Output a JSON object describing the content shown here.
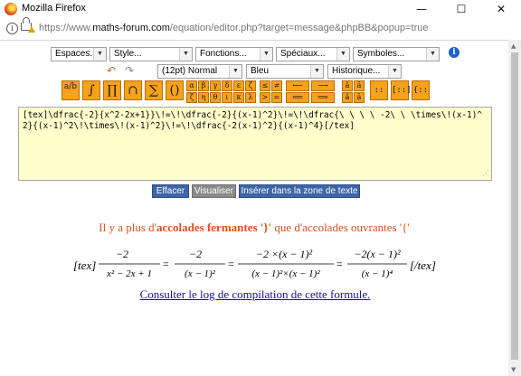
{
  "window": {
    "title": "Mozilla Firefox",
    "minimize_glyph": "—",
    "maximize_glyph": "☐",
    "close_glyph": "✕"
  },
  "address_bar": {
    "url_prefix": "https://www.",
    "url_domain": "maths-forum.com",
    "url_path": "/equation/editor.php?target=message&phpBB&popup=true"
  },
  "toolbar": {
    "selects_row1": [
      "Espaces...",
      "Style...",
      "Fonctions...",
      "Spéciaux...",
      "Symboles..."
    ],
    "selects_row2": [
      "(12pt) Normal",
      "Bleu",
      "Historique..."
    ],
    "info_label": "i",
    "undo_icon": "undo-arrow-icon",
    "redo_icon": "redo-arrow-icon",
    "big_buttons": [
      "a/b",
      "∫",
      "∏",
      "∩",
      "∑",
      "()"
    ],
    "greek_row1": [
      "α",
      "β",
      "γ",
      "δ",
      "ε",
      "ζ"
    ],
    "greek_row2": [
      "ζ",
      "η",
      "θ",
      "ι",
      "κ",
      "λ"
    ],
    "rel_row1": [
      "≤",
      "≠"
    ],
    "rel_row2": [
      ">",
      "="
    ],
    "arrows_row1": [
      "⟵",
      "⟶"
    ],
    "arrows_row2": [
      "⟸",
      "⟹"
    ],
    "accent_row1": [
      "â",
      "ā"
    ],
    "accent_row2": [
      "ä",
      "ā"
    ],
    "matrix_buttons": [
      "::",
      "[::]",
      "{::"
    ],
    "accent_color": "#f6a21c"
  },
  "editor": {
    "content": "[tex]\\dfrac{-2}{x^2-2x+1}}\\!=\\!\\dfrac{-2}{(x-1)^2}\\!=\\!\\dfrac{\\ \\ \\ \\ -2\\ \\ \\times\\!(x-1)^2}{(x-1)^2\\!\\times\\!(x-1)^2}\\!=\\!\\dfrac{-2(x-1)^2}{(x-1)^4}[/tex]"
  },
  "buttons": {
    "clear": "Effacer",
    "preview": "Visualiser",
    "insert": "Insérer dans la zone de texte"
  },
  "message": {
    "before": "Il y a plus d'",
    "bold": "accolades fermantes '}'",
    "after": " que d'accolades ouvrantes '{'",
    "color": "#d8541b"
  },
  "formula": {
    "open_tag": "[tex]",
    "close_tag": "[/tex]",
    "frac1_num": "−2",
    "frac1_den": "x² − 2x + 1",
    "frac2_num": "−2",
    "frac2_den": "(x − 1)²",
    "frac3_num": "−2   ×(x − 1)²",
    "frac3_den": "(x − 1)²×(x − 1)²",
    "frac4_num": "−2(x − 1)²",
    "frac4_den": "(x − 1)⁴",
    "equals": "="
  },
  "log_link": "Consulter le log de compilation de cette formule."
}
